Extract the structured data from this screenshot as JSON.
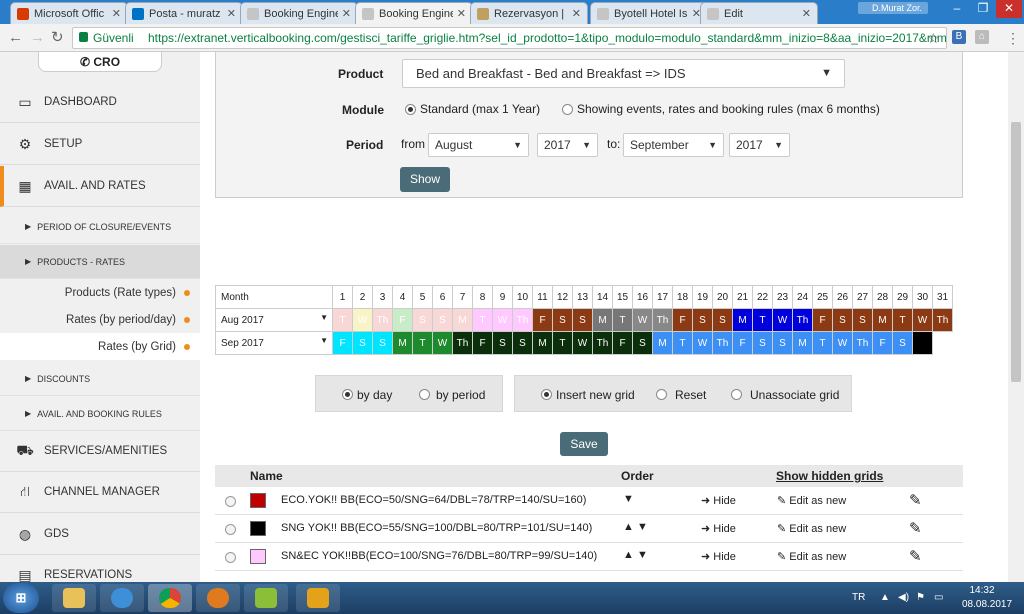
{
  "browser": {
    "tabs": [
      {
        "label": "Microsoft Offic",
        "color": "#d83b01"
      },
      {
        "label": "Posta - muratz",
        "color": "#0072c6"
      },
      {
        "label": "Booking Engine",
        "color": "#c5c5c5"
      },
      {
        "label": "Booking Engine",
        "color": "#c5c5c5"
      },
      {
        "label": "Rezervasyon | E",
        "color": "#c0a060"
      },
      {
        "label": "Byotell Hotel Is",
        "color": "#c5c5c5"
      },
      {
        "label": "Edit",
        "color": "#c5c5c5"
      }
    ],
    "user": "D.Murat Zor.",
    "security_label": "Güvenli",
    "url": "https://extranet.verticalbooking.com/gestisci_tariffe_griglie.htm?sel_id_prodotto=1&tipo_modulo=modulo_standard&mm_inizio=8&aa_inizio=2017&mm"
  },
  "sidebar": {
    "cro": "CRO",
    "menu": [
      {
        "label": "DASHBOARD",
        "icon": "monitor-icon"
      },
      {
        "label": "SETUP",
        "icon": "gears-icon"
      },
      {
        "label": "AVAIL. AND RATES",
        "icon": "grid-icon"
      }
    ],
    "subs": [
      "PERIOD OF CLOSURE/EVENTS",
      "PRODUCTS - RATES"
    ],
    "sub_items": [
      "Products (Rate types)",
      "Rates (by period/day)",
      "Rates (by Grid)"
    ],
    "subs2": [
      "DISCOUNTS",
      "AVAIL. AND BOOKING RULES"
    ],
    "menu2": [
      {
        "label": "SERVICES/AMENITIES",
        "icon": "car-icon"
      },
      {
        "label": "CHANNEL MANAGER",
        "icon": "network-icon"
      },
      {
        "label": "GDS",
        "icon": "globe-icon"
      },
      {
        "label": "RESERVATIONS",
        "icon": "calendar-icon"
      }
    ]
  },
  "form": {
    "product_label": "Product",
    "product_value": "Bed and Breakfast - Bed and Breakfast => IDS",
    "module_label": "Module",
    "module_opt1": "Standard (max 1 Year)",
    "module_opt2": "Showing events, rates and booking rules (max 6 months)",
    "period_label": "Period",
    "from_label": "from",
    "from_month": "August",
    "from_year": "2017",
    "to_label": "to:",
    "to_month": "September",
    "to_year": "2017",
    "show_button": "Show"
  },
  "calendar": {
    "header_label": "Month",
    "days": [
      "1",
      "2",
      "3",
      "4",
      "5",
      "6",
      "7",
      "8",
      "9",
      "10",
      "11",
      "12",
      "13",
      "14",
      "15",
      "16",
      "17",
      "18",
      "19",
      "20",
      "21",
      "22",
      "23",
      "24",
      "25",
      "26",
      "27",
      "28",
      "29",
      "30",
      "31"
    ],
    "rows": [
      {
        "month": "Aug 2017",
        "cells": [
          [
            "T",
            "#f8d7d7"
          ],
          [
            "W",
            "#f9f3c8"
          ],
          [
            "Th",
            "#f8d7d7"
          ],
          [
            "F",
            "#c8ecc8"
          ],
          [
            "S",
            "#f8d7d7"
          ],
          [
            "S",
            "#f8d7d7"
          ],
          [
            "M",
            "#f8d7d7"
          ],
          [
            "T",
            "#ffc8ff"
          ],
          [
            "W",
            "#ffc8ff"
          ],
          [
            "Th",
            "#ffc8ff"
          ],
          [
            "F",
            "#8b3a14"
          ],
          [
            "S",
            "#8b3a14"
          ],
          [
            "S",
            "#8b3a14"
          ],
          [
            "M",
            "#777777"
          ],
          [
            "T",
            "#777777"
          ],
          [
            "W",
            "#888888"
          ],
          [
            "Th",
            "#888888"
          ],
          [
            "F",
            "#8b3a14"
          ],
          [
            "S",
            "#8b3a14"
          ],
          [
            "S",
            "#8b3a14"
          ],
          [
            "M",
            "#0000dd"
          ],
          [
            "T",
            "#0000dd"
          ],
          [
            "W",
            "#0000dd"
          ],
          [
            "Th",
            "#0000dd"
          ],
          [
            "F",
            "#8b3a14"
          ],
          [
            "S",
            "#8b3a14"
          ],
          [
            "S",
            "#8b3a14"
          ],
          [
            "M",
            "#8b3a14"
          ],
          [
            "T",
            "#8b3a14"
          ],
          [
            "W",
            "#8b3a14"
          ],
          [
            "Th",
            "#8b3a14"
          ]
        ]
      },
      {
        "month": "Sep 2017",
        "cells": [
          [
            "F",
            "#00e5ff"
          ],
          [
            "S",
            "#00e5ff"
          ],
          [
            "S",
            "#00e5ff"
          ],
          [
            "M",
            "#1e8a2e"
          ],
          [
            "T",
            "#1e8a2e"
          ],
          [
            "W",
            "#1e8a2e"
          ],
          [
            "Th",
            "#0b2e0b"
          ],
          [
            "F",
            "#0b2e0b"
          ],
          [
            "S",
            "#0b2e0b"
          ],
          [
            "S",
            "#0b2e0b"
          ],
          [
            "M",
            "#0b2e0b"
          ],
          [
            "T",
            "#0b2e0b"
          ],
          [
            "W",
            "#0b2e0b"
          ],
          [
            "Th",
            "#0b2e0b"
          ],
          [
            "F",
            "#0b2e0b"
          ],
          [
            "S",
            "#0b2e0b"
          ],
          [
            "M",
            "#3b8ff5"
          ],
          [
            "T",
            "#3b8ff5"
          ],
          [
            "W",
            "#3b8ff5"
          ],
          [
            "Th",
            "#3b8ff5"
          ],
          [
            "F",
            "#3b8ff5"
          ],
          [
            "S",
            "#3b8ff5"
          ],
          [
            "S",
            "#3b8ff5"
          ],
          [
            "M",
            "#3b8ff5"
          ],
          [
            "T",
            "#3b8ff5"
          ],
          [
            "W",
            "#3b8ff5"
          ],
          [
            "Th",
            "#3b8ff5"
          ],
          [
            "F",
            "#3b8ff5"
          ],
          [
            "S",
            "#3b8ff5"
          ],
          [
            "",
            "#000000"
          ]
        ]
      }
    ]
  },
  "options": {
    "by_day": "by day",
    "by_period": "by period",
    "insert_new_grid": "Insert new grid",
    "reset": "Reset",
    "unassociate_grid": "Unassociate grid"
  },
  "save_button": "Save",
  "grid_table": {
    "col_name": "Name",
    "col_order": "Order",
    "show_hidden": "Show hidden grids",
    "rows": [
      {
        "color": "#c00000",
        "name": "ECO.YOK!! BB(ECO=50/SNG=64/DBL=78/TRP=140/SU=160)",
        "order": "▼",
        "hide": "Hide",
        "edit_new": "Edit as new"
      },
      {
        "color": "#000000",
        "name": "SNG YOK!! BB(ECO=55/SNG=100/DBL=80/TRP=101/SU=140)",
        "order": "▲ ▼",
        "hide": "Hide",
        "edit_new": "Edit as new"
      },
      {
        "color": "#ffc8ff",
        "name": "SN&EC YOK!!BB(ECO=100/SNG=76/DBL=80/TRP=99/SU=140)",
        "order": "▲ ▼",
        "hide": "Hide",
        "edit_new": "Edit as new"
      }
    ]
  },
  "taskbar": {
    "lang": "TR",
    "time": "14:32",
    "date": "08.08.2017"
  }
}
